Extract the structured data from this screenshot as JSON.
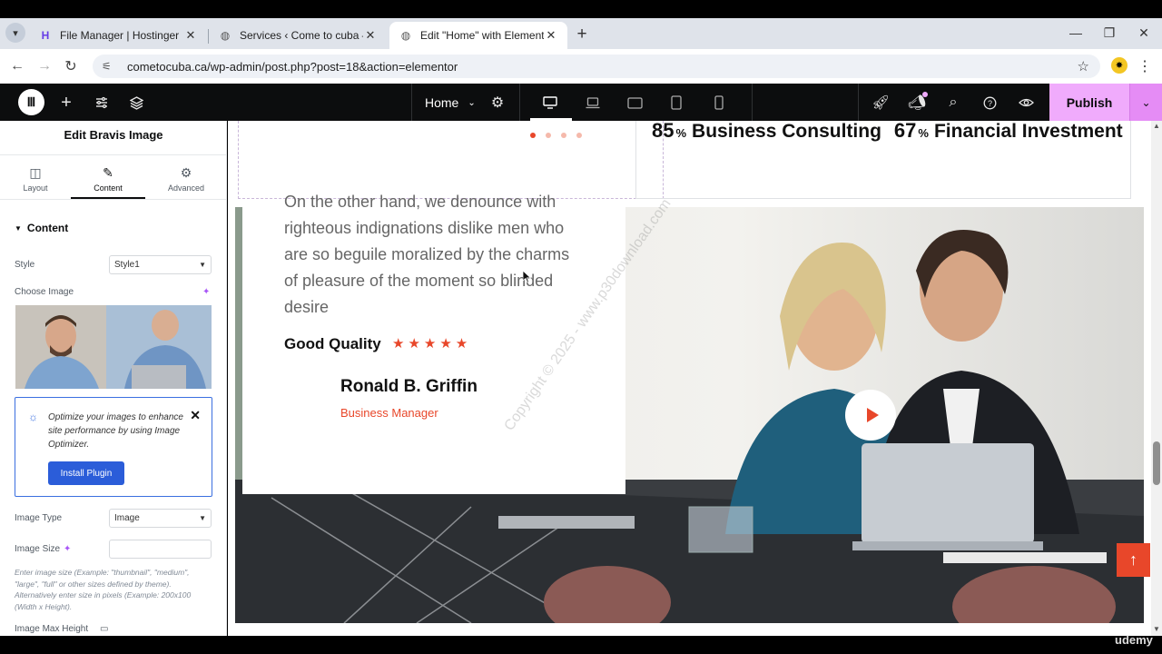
{
  "browser": {
    "tabs": [
      {
        "title": "File Manager | Hostinger",
        "favicon": "hostinger-icon"
      },
      {
        "title": "Services ‹ Come to cuba — Wo",
        "favicon": "wordpress-icon"
      },
      {
        "title": "Edit \"Home\" with Elementor",
        "favicon": "wordpress-icon"
      }
    ],
    "url": "cometocuba.ca/wp-admin/post.php?post=18&action=elementor"
  },
  "editor": {
    "page_name": "Home",
    "publish_label": "Publish"
  },
  "panel": {
    "title": "Edit Bravis Image",
    "tabs": [
      {
        "label": "Layout",
        "icon": "layout-icon"
      },
      {
        "label": "Content",
        "icon": "pencil-icon"
      },
      {
        "label": "Advanced",
        "icon": "gear-icon"
      }
    ],
    "section": "Content",
    "style_label": "Style",
    "style_value": "Style1",
    "choose_image_label": "Choose Image",
    "notice_text": "Optimize your images to enhance site performance by using Image Optimizer.",
    "install_button": "Install Plugin",
    "image_type_label": "Image Type",
    "image_type_value": "Image",
    "image_size_label": "Image Size",
    "image_size_value": "",
    "help_text": "Enter image size (Example: \"thumbnail\", \"medium\", \"large\", \"full\" or other sizes defined by theme). Alternatively enter size in pixels (Example: 200x100 (Width x Height).",
    "max_height_label": "Image Max Height"
  },
  "canvas": {
    "stats": [
      {
        "value": "85",
        "unit": "%",
        "label": "Business Consulting"
      },
      {
        "value": "67",
        "unit": "%",
        "label": "Financial Investment"
      }
    ],
    "testimonial": {
      "quote": "On the other hand, we denounce with righteous indignations dislike men who are so beguile moralized by the charms of pleasure of the moment so blinded desire",
      "rating_label": "Good Quality",
      "stars": "★★★★★",
      "rating": 5,
      "name": "Ronald B. Griffin",
      "role": "Business Manager"
    },
    "watermark": "Copyright © 2025 - www.p30download.com"
  },
  "overlay": {
    "brand": "udemy"
  },
  "colors": {
    "accent": "#e8472a",
    "publish": "#f0abfc",
    "elementor_bar": "#0c0d0e",
    "notice_border": "#3b6fe0"
  }
}
